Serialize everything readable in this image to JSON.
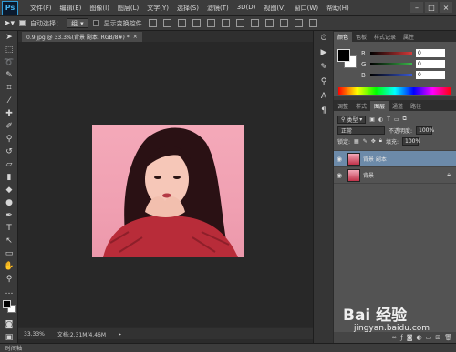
{
  "app": {
    "logo": "Ps",
    "menus": [
      "文件(F)",
      "编辑(E)",
      "图像(I)",
      "图层(L)",
      "文字(Y)",
      "选择(S)",
      "滤镜(T)",
      "3D(D)",
      "视图(V)",
      "窗口(W)",
      "帮助(H)"
    ]
  },
  "window_controls": {
    "minimize": "–",
    "maximize": "□",
    "close": "×"
  },
  "options": {
    "auto_select_label": "自动选择：",
    "auto_select_value": "组",
    "show_transform_label": "显示变换控件"
  },
  "document": {
    "tab_title": "0.9.jpg @ 33.3%(背景 副本, RGB/8#) *",
    "close": "×",
    "zoom": "33.33%",
    "doc_info": "文档:2.31M/4.46M"
  },
  "timeline_label": "时间轴",
  "color_panel": {
    "tabs": [
      "颜色",
      "色板",
      "样式记录",
      "属性"
    ],
    "foreground": "#000000",
    "background": "#ffffff",
    "sliders": [
      {
        "letter": "R",
        "value": "0",
        "color": "#d63a3a"
      },
      {
        "letter": "G",
        "value": "0",
        "color": "#3ab84a"
      },
      {
        "letter": "B",
        "value": "0",
        "color": "#3a5ad6"
      }
    ]
  },
  "layers_panel": {
    "tabs": [
      "调整",
      "样式",
      "图层",
      "通道",
      "路径"
    ],
    "filter_kind": "类型",
    "blend_mode": "正常",
    "opacity_label": "不透明度:",
    "opacity_value": "100%",
    "lock_label": "锁定:",
    "fill_label": "填充:",
    "fill_value": "100%",
    "layers": [
      {
        "name": "背景 副本",
        "selected": true,
        "locked": false
      },
      {
        "name": "背景",
        "selected": false,
        "locked": true
      }
    ]
  },
  "watermark": {
    "brand": "Bai 经验",
    "url": "jingyan.baidu.com"
  }
}
